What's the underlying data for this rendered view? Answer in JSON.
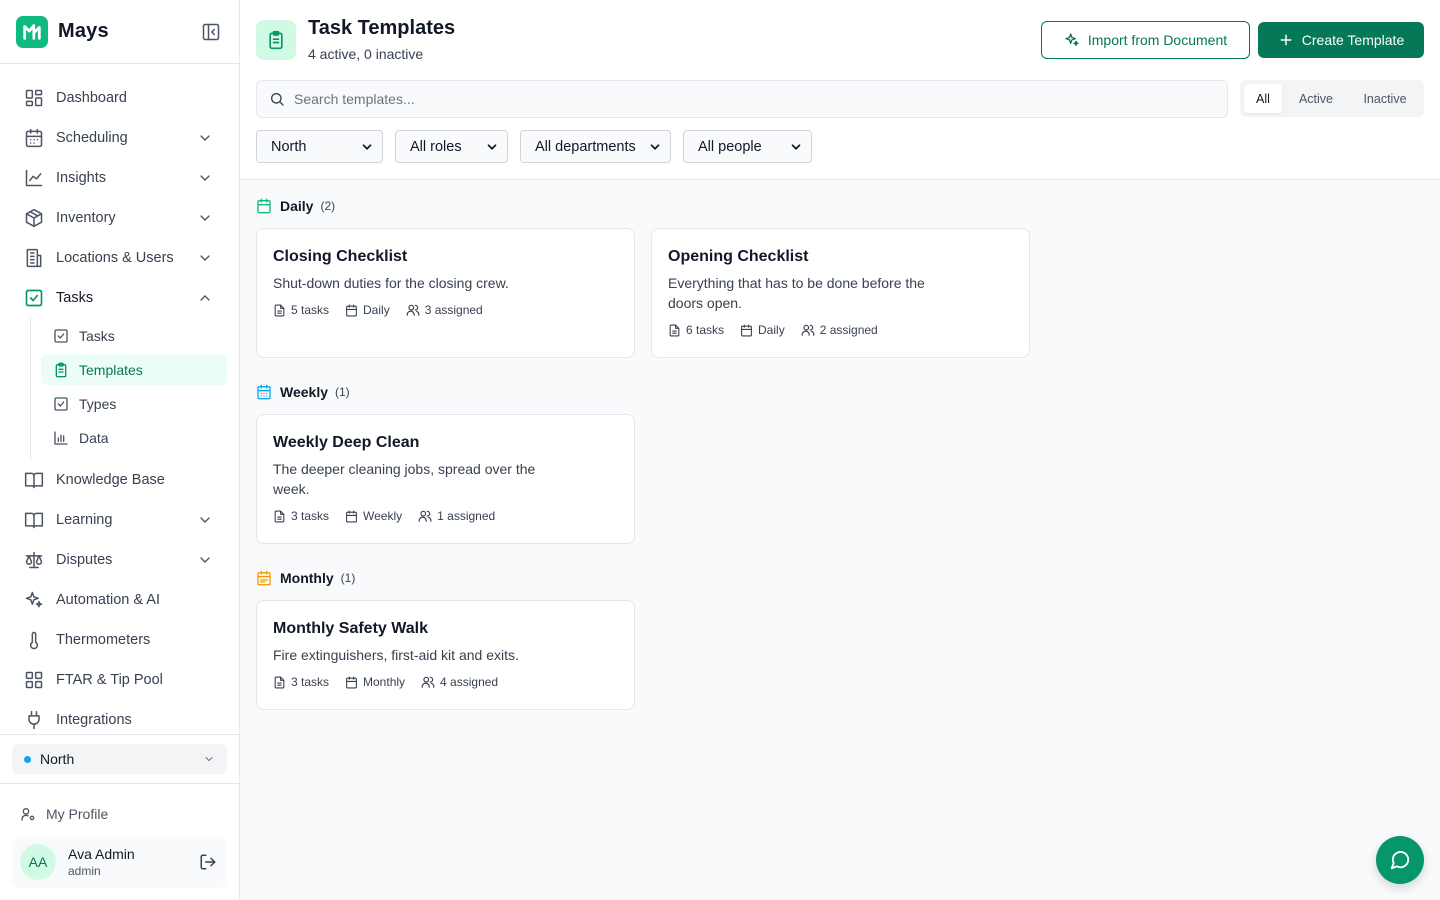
{
  "app": {
    "name": "Mays"
  },
  "sidebar": {
    "items": [
      {
        "label": "Dashboard",
        "icon": "dashboard-icon"
      },
      {
        "label": "Scheduling",
        "icon": "calendar-icon",
        "expandable": true
      },
      {
        "label": "Insights",
        "icon": "chart-line-icon",
        "expandable": true
      },
      {
        "label": "Inventory",
        "icon": "package-icon",
        "expandable": true
      },
      {
        "label": "Locations & Users",
        "icon": "building-icon",
        "expandable": true
      },
      {
        "label": "Tasks",
        "icon": "square-check-icon",
        "expandable": true,
        "expanded": true
      },
      {
        "label": "Knowledge Base",
        "icon": "book-icon"
      },
      {
        "label": "Learning",
        "icon": "book-open-icon",
        "expandable": true
      },
      {
        "label": "Disputes",
        "icon": "scale-icon",
        "expandable": true
      },
      {
        "label": "Automation & AI",
        "icon": "sparkles-icon"
      },
      {
        "label": "Thermometers",
        "icon": "thermometer-icon"
      },
      {
        "label": "FTAR & Tip Pool",
        "icon": "grid-icon"
      },
      {
        "label": "Integrations",
        "icon": "plug-icon"
      }
    ],
    "tasks_sub": [
      {
        "label": "Tasks",
        "icon": "square-check-icon"
      },
      {
        "label": "Templates",
        "icon": "clipboard-icon",
        "active": true
      },
      {
        "label": "Types",
        "icon": "square-check-icon"
      },
      {
        "label": "Data",
        "icon": "bar-chart-icon"
      }
    ],
    "location": "North",
    "my_profile": "My Profile",
    "user": {
      "initials": "AA",
      "name": "Ava Admin",
      "role": "admin"
    }
  },
  "header": {
    "title": "Task Templates",
    "subtitle": "4 active, 0 inactive",
    "import_label": "Import from Document",
    "create_label": "Create Template"
  },
  "search": {
    "placeholder": "Search templates...",
    "value": ""
  },
  "status_filter": {
    "options": [
      "All",
      "Active",
      "Inactive"
    ],
    "selected": "All"
  },
  "filters": {
    "location": "North",
    "roles": "All roles",
    "departments": "All departments",
    "people": "All people"
  },
  "groups": [
    {
      "name": "Daily",
      "count": "(2)",
      "color": "#10b981",
      "templates": [
        {
          "title": "Closing Checklist",
          "description": "Shut-down duties for the closing crew.",
          "tasks": "5 tasks",
          "frequency": "Daily",
          "assigned": "3 assigned"
        },
        {
          "title": "Opening Checklist",
          "description": "Everything that has to be done before the doors open.",
          "tasks": "6 tasks",
          "frequency": "Daily",
          "assigned": "2 assigned"
        }
      ]
    },
    {
      "name": "Weekly",
      "count": "(1)",
      "color": "#0ea5e9",
      "templates": [
        {
          "title": "Weekly Deep Clean",
          "description": "The deeper cleaning jobs, spread over the week.",
          "tasks": "3 tasks",
          "frequency": "Weekly",
          "assigned": "1 assigned"
        }
      ]
    },
    {
      "name": "Monthly",
      "count": "(1)",
      "color": "#f59e0b",
      "templates": [
        {
          "title": "Monthly Safety Walk",
          "description": "Fire extinguishers, first-aid kit and exits.",
          "tasks": "3 tasks",
          "frequency": "Monthly",
          "assigned": "4 assigned"
        }
      ]
    }
  ],
  "colors": {
    "accent": "#047857",
    "accent_light": "#d1fae5",
    "brand": "#10b981"
  }
}
